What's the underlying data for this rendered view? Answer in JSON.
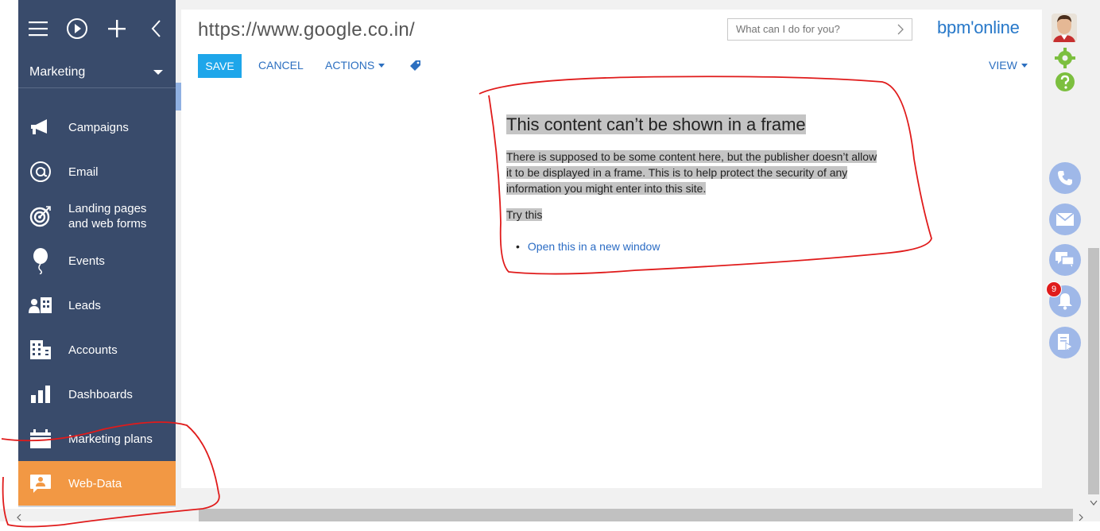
{
  "app": {
    "brand": "bpm'online",
    "brand_color": "#2778c9"
  },
  "header": {
    "url_title": "https://www.google.co.in/",
    "search_placeholder": "What can I do for you?"
  },
  "toolbar": {
    "save": "SAVE",
    "cancel": "CANCEL",
    "actions": "ACTIONS",
    "view": "VIEW"
  },
  "sidebar": {
    "workspace": "Marketing",
    "items": [
      {
        "label": "Campaigns",
        "icon": "megaphone-icon"
      },
      {
        "label": "Email",
        "icon": "at-icon"
      },
      {
        "label": "Landing pages and web forms",
        "icon": "target-icon"
      },
      {
        "label": "Events",
        "icon": "balloon-icon"
      },
      {
        "label": "Leads",
        "icon": "leads-icon"
      },
      {
        "label": "Accounts",
        "icon": "building-icon"
      },
      {
        "label": "Dashboards",
        "icon": "bar-chart-icon"
      },
      {
        "label": "Marketing plans",
        "icon": "calendar-icon"
      },
      {
        "label": "Web-Data",
        "icon": "contact-card-icon",
        "active": true
      }
    ]
  },
  "frame_message": {
    "title": "This content can’t be shown in a frame",
    "body": "There is supposed to be some content here, but the publisher doesn’t allow it to be displayed in a frame. This is to help protect the security of any information you might enter into this site.",
    "try_this": "Try this",
    "link": "Open this in a new window"
  },
  "right_panel": {
    "notification_count": "9",
    "buttons": [
      "phone-icon",
      "mail-icon",
      "chat-icon",
      "bell-icon",
      "feed-icon"
    ]
  },
  "colors": {
    "sidebar": "#394b6b",
    "active_item": "#f29844",
    "save_button": "#1ea6ea",
    "link": "#2b6cc4",
    "annotation": "#e01b1b"
  }
}
